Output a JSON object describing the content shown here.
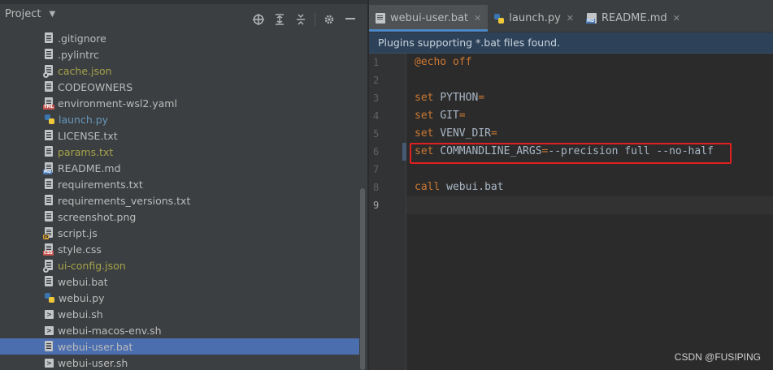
{
  "project_panel": {
    "title": "Project",
    "files": [
      {
        "name": ".gitignore",
        "icon": "text-file-icon",
        "tag": "",
        "status": "normal"
      },
      {
        "name": ".pylintrc",
        "icon": "text-file-icon",
        "tag": "",
        "status": "normal"
      },
      {
        "name": "cache.json",
        "icon": "json-file-icon",
        "tag": "",
        "status": "ignored"
      },
      {
        "name": "CODEOWNERS",
        "icon": "text-file-icon",
        "tag": "",
        "status": "normal"
      },
      {
        "name": "environment-wsl2.yaml",
        "icon": "yaml-file-icon",
        "tag": "YML",
        "status": "normal"
      },
      {
        "name": "launch.py",
        "icon": "python-file-icon",
        "tag": "",
        "status": "modified"
      },
      {
        "name": "LICENSE.txt",
        "icon": "text-file-icon",
        "tag": "",
        "status": "normal"
      },
      {
        "name": "params.txt",
        "icon": "text-file-icon",
        "tag": "",
        "status": "ignored"
      },
      {
        "name": "README.md",
        "icon": "markdown-file-icon",
        "tag": "MD",
        "status": "normal"
      },
      {
        "name": "requirements.txt",
        "icon": "text-file-icon",
        "tag": "",
        "status": "normal"
      },
      {
        "name": "requirements_versions.txt",
        "icon": "text-file-icon",
        "tag": "",
        "status": "normal"
      },
      {
        "name": "screenshot.png",
        "icon": "image-file-icon",
        "tag": "",
        "status": "normal"
      },
      {
        "name": "script.js",
        "icon": "javascript-file-icon",
        "tag": "JS",
        "status": "normal"
      },
      {
        "name": "style.css",
        "icon": "css-file-icon",
        "tag": "CSS",
        "status": "normal"
      },
      {
        "name": "ui-config.json",
        "icon": "json-file-icon",
        "tag": "",
        "status": "ignored"
      },
      {
        "name": "webui.bat",
        "icon": "text-file-icon",
        "tag": "",
        "status": "normal"
      },
      {
        "name": "webui.py",
        "icon": "python-file-icon",
        "tag": "",
        "status": "normal"
      },
      {
        "name": "webui.sh",
        "icon": "shell-file-icon",
        "tag": "",
        "status": "normal"
      },
      {
        "name": "webui-macos-env.sh",
        "icon": "shell-file-icon",
        "tag": "",
        "status": "normal"
      },
      {
        "name": "webui-user.bat",
        "icon": "text-file-icon",
        "tag": "",
        "status": "selected"
      },
      {
        "name": "webui-user.sh",
        "icon": "shell-file-icon",
        "tag": "",
        "status": "normal"
      }
    ]
  },
  "tabs": [
    {
      "label": "webui-user.bat",
      "icon": "bat-file-icon",
      "active": true
    },
    {
      "label": "launch.py",
      "icon": "python-file-icon",
      "active": false
    },
    {
      "label": "README.md",
      "icon": "markdown-file-icon",
      "active": false
    }
  ],
  "notification": "Plugins supporting *.bat files found.",
  "code_lines": [
    {
      "n": "1",
      "tokens": [
        {
          "t": "@echo off",
          "c": "kw"
        }
      ]
    },
    {
      "n": "2",
      "tokens": []
    },
    {
      "n": "3",
      "tokens": [
        {
          "t": "set ",
          "c": "kw"
        },
        {
          "t": "PYTHON",
          "c": "id"
        },
        {
          "t": "=",
          "c": "kw"
        }
      ]
    },
    {
      "n": "4",
      "tokens": [
        {
          "t": "set ",
          "c": "kw"
        },
        {
          "t": "GIT",
          "c": "id"
        },
        {
          "t": "=",
          "c": "kw"
        }
      ]
    },
    {
      "n": "5",
      "tokens": [
        {
          "t": "set ",
          "c": "kw"
        },
        {
          "t": "VENV_DIR",
          "c": "id"
        },
        {
          "t": "=",
          "c": "kw"
        }
      ]
    },
    {
      "n": "6",
      "tokens": [
        {
          "t": "set ",
          "c": "kw"
        },
        {
          "t": "COMMANDLINE_ARGS",
          "c": "id"
        },
        {
          "t": "=",
          "c": "kw"
        },
        {
          "t": "--precision full --no-half",
          "c": "val"
        }
      ]
    },
    {
      "n": "7",
      "tokens": []
    },
    {
      "n": "8",
      "tokens": [
        {
          "t": "call ",
          "c": "kw"
        },
        {
          "t": "webui.bat",
          "c": "id"
        }
      ]
    },
    {
      "n": "9",
      "tokens": []
    }
  ],
  "current_line": "9",
  "watermark": "CSDN @FUSIPING",
  "colors": {
    "selection": "#4b6eaf",
    "keyword": "#cc7832",
    "highlight_box": "#e02020"
  }
}
